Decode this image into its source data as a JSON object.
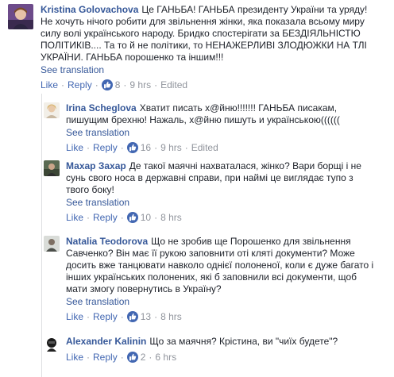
{
  "ui": {
    "like_label": "Like",
    "reply_label": "Reply",
    "see_translation": "See translation",
    "edited_label": "Edited"
  },
  "comments": [
    {
      "author": "Kristina Golovachova",
      "text": "Це ГАНЬБА! ГАНЬБА президенту України та уряду! Не хочуть нічого робити для звільнення жінки, яка показала всьому миру силу волі українського народу. Бридко спостерігати за БЕЗДІЯЛЬНІСТЮ ПОЛІТИКІВ.... Та то й не політики, то НЕНАЖЕРЛИВІ ЗЛОДЮЖКИ НА ТЛІ УКРАЇНИ. ГАНЬБА порошенко та іншим!!!",
      "likes": "8",
      "time": "9 hrs",
      "edited": true
    },
    {
      "author": "Irina Scheglova",
      "text": "Хватит писать х@йню!!!!!!! ГАНЬБА писакам, пишущим брехню! Нажаль, х@йню пишуть и українською((((((",
      "likes": "16",
      "time": "9 hrs",
      "edited": true
    },
    {
      "author": "Махар Захар",
      "text": "Де такої маячні нахваталася, жінко? Вари борщі і не сунь свого носа в державні справи, при наймі це виглядає тупо з твого боку!",
      "likes": "10",
      "time": "8 hrs",
      "edited": false
    },
    {
      "author": "Natalia Teodorova",
      "text": "Що не зробив ще Порошенко для звільнення Савченко? Він має її рукою заповнити оті кляті документи? Може досить вже танцювати навколо однієї полоненої, коли є дуже багато і інших українських полонених, які б заповнили всі документи, щоб мати змогу повернутись в Україну?",
      "likes": "13",
      "time": "8 hrs",
      "edited": false
    },
    {
      "author": "Alexander Kalinin",
      "text": "Що за маячня? Крістина, ви \"чиїх будете\"?",
      "likes": "2",
      "time": "6 hrs",
      "edited": false
    }
  ],
  "colors": {
    "link": "#365899",
    "action": "#4267b2",
    "meta": "#90949c",
    "text": "#1d2129"
  }
}
